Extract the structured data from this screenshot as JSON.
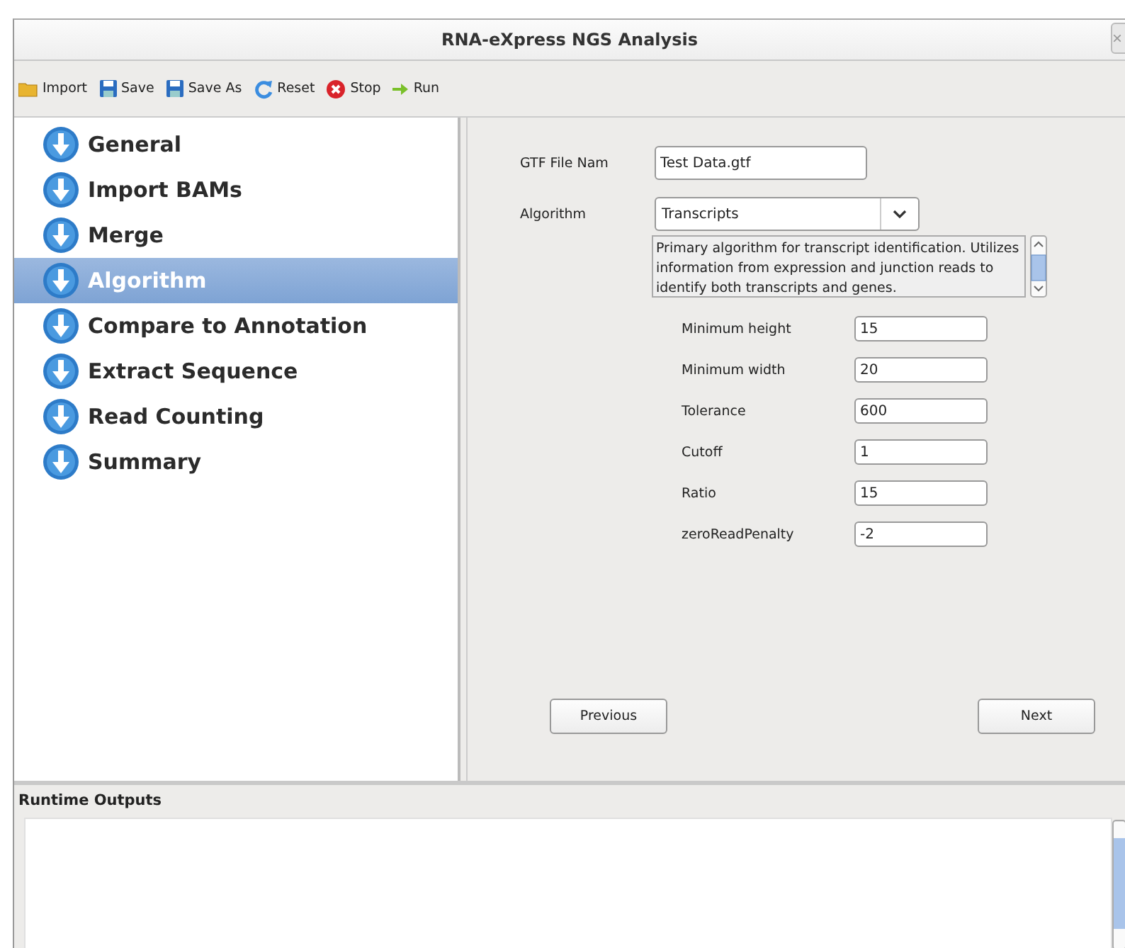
{
  "window": {
    "title": "RNA-eXpress NGS Analysis",
    "close": "×"
  },
  "toolbar": [
    {
      "kind": "folder",
      "label": "Import"
    },
    {
      "kind": "save",
      "label": "Save"
    },
    {
      "kind": "save",
      "label": "Save As"
    },
    {
      "kind": "reset",
      "label": "Reset"
    },
    {
      "kind": "stop",
      "label": "Stop"
    },
    {
      "kind": "run",
      "label": "Run"
    }
  ],
  "steps": [
    {
      "label": "General",
      "selected": false
    },
    {
      "label": "Import BAMs",
      "selected": false
    },
    {
      "label": "Merge",
      "selected": false
    },
    {
      "label": "Algorithm",
      "selected": true
    },
    {
      "label": "Compare to Annotation",
      "selected": false
    },
    {
      "label": "Extract Sequence",
      "selected": false
    },
    {
      "label": "Read Counting",
      "selected": false
    },
    {
      "label": "Summary",
      "selected": false
    }
  ],
  "form": {
    "gtf_label": "GTF File Nam",
    "gtf_value": "Test Data.gtf",
    "algorithm_label": "Algorithm",
    "algorithm_value": "Transcripts",
    "description": "Primary algorithm for transcript identification. Utilizes information from expression and junction reads to identify both transcripts and genes.",
    "params": [
      {
        "label": "Minimum height",
        "value": "15"
      },
      {
        "label": "Minimum width",
        "value": "20"
      },
      {
        "label": "Tolerance",
        "value": "600"
      },
      {
        "label": "Cutoff",
        "value": "1"
      },
      {
        "label": "Ratio",
        "value": "15"
      },
      {
        "label": "zeroReadPenalty",
        "value": "-2"
      }
    ],
    "previous": "Previous",
    "next": "Next"
  },
  "output": {
    "title": "Runtime Outputs"
  }
}
